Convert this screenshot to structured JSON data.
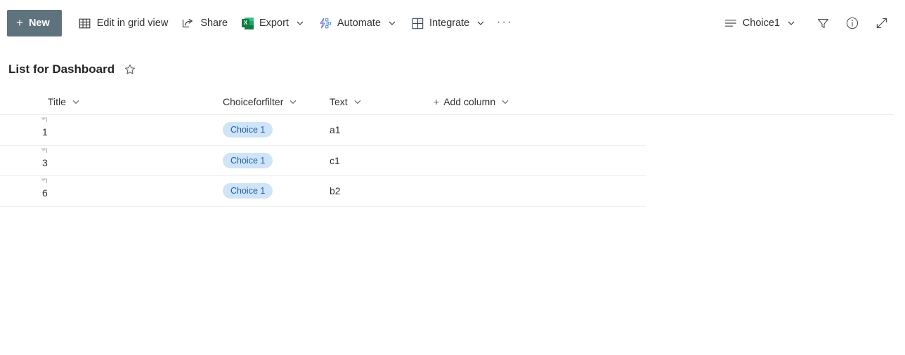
{
  "commandbar": {
    "new_button": {
      "label": "New",
      "icon": "plus-icon"
    },
    "items": [
      {
        "label": "Edit in grid view",
        "icon": "grid-icon",
        "has_chevron": false
      },
      {
        "label": "Share",
        "icon": "share-icon",
        "has_chevron": false
      },
      {
        "label": "Export",
        "icon": "excel-icon",
        "has_chevron": true
      },
      {
        "label": "Automate",
        "icon": "automate-icon",
        "has_chevron": true
      },
      {
        "label": "Integrate",
        "icon": "integrate-icon",
        "has_chevron": true
      }
    ],
    "overflow": {
      "label": "···",
      "icon": "ellipsis-icon"
    },
    "view_selector": {
      "label": "Choice1",
      "icon": "list-view-icon",
      "chevron": "chevron-down-icon"
    },
    "filter_button": {
      "icon": "filter-icon"
    },
    "info_button": {
      "icon": "info-icon"
    },
    "expand_button": {
      "icon": "expand-diagonal-icon"
    }
  },
  "page": {
    "title": "List for Dashboard",
    "favorite_icon": "star-icon"
  },
  "grid": {
    "columns": [
      {
        "label": "Title",
        "chevron": "chevron-down-icon"
      },
      {
        "label": "Choiceforfilter",
        "chevron": "chevron-down-icon"
      },
      {
        "label": "Text",
        "chevron": "chevron-down-icon"
      }
    ],
    "add_column": {
      "plus": "+",
      "label": "Add column",
      "chevron": "chevron-down-icon"
    },
    "rows": [
      {
        "title": "1",
        "choiceforfilter": "Choice 1",
        "text": "a1"
      },
      {
        "title": "3",
        "choiceforfilter": "Choice 1",
        "text": "c1"
      },
      {
        "title": "6",
        "choiceforfilter": "Choice 1",
        "text": "b2"
      }
    ]
  },
  "colors": {
    "new_button_bg": "#5f737e",
    "pill_bg": "#cfe4f7",
    "pill_text": "#24609b",
    "excel_green": "#107c41",
    "row_divider": "#f0eff0"
  }
}
